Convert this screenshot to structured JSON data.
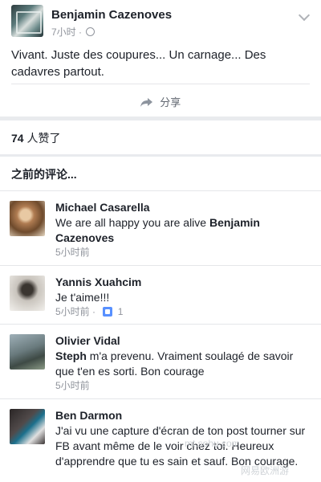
{
  "post": {
    "author": "Benjamin Cazenoves",
    "time": "7小时",
    "text": "Vivant. Juste des coupures... Un carnage... Des cadavres partout.",
    "share_label": "分享"
  },
  "likes": {
    "count": "74",
    "suffix": " 人赞了"
  },
  "previous_comments_label": "之前的评论...",
  "comments": [
    {
      "name": "Michael Casarella",
      "text": "We are all happy you are alive ",
      "mention": "Benjamin Cazenoves",
      "time": "5小时前"
    },
    {
      "name": "Yannis Xuahcim",
      "text": "Je t'aime!!!",
      "time": "5小时前",
      "like_count": "1"
    },
    {
      "name": "Olivier Vidal",
      "mention": "Steph",
      "text": " m'a prevenu. Vraiment soulagé de savoir que t'en es sorti. Bon courage",
      "time": "5小时前"
    },
    {
      "name": "Ben Darmon",
      "text": "J'ai vu une capture d'écran de ton post tourner sur FB avant même de le voir chez toi. Heureux d'apprendre que tu es sain et sauf. Bon courage."
    }
  ],
  "watermark": {
    "line1": "mt.sohu.com",
    "line2": "网易欧洲游"
  },
  "colors": {
    "text": "#1d2129",
    "meta": "#90949c",
    "separator": "#e9ebee",
    "like_blue": "#5890ff"
  }
}
